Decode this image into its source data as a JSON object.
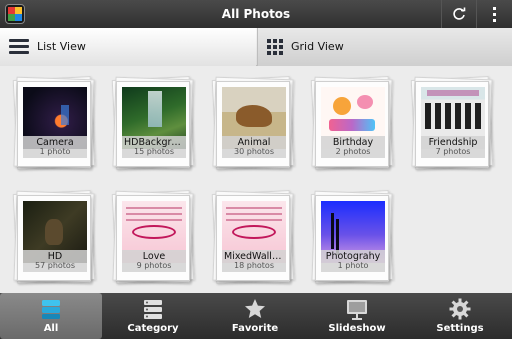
{
  "header": {
    "title": "All Photos",
    "app_icon": "app-logo-icon",
    "refresh_icon": "refresh-icon",
    "menu_icon": "overflow-menu-icon"
  },
  "view_toggle": {
    "list_label": "List View",
    "grid_label": "Grid View",
    "selected": "list"
  },
  "albums": [
    {
      "name": "Camera",
      "count": "1 photo",
      "thumb": "t-camera"
    },
    {
      "name": "HDBackgrou...",
      "count": "15 photos",
      "thumb": "t-hd"
    },
    {
      "name": "Animal",
      "count": "30 photos",
      "thumb": "t-animal"
    },
    {
      "name": "Birthday",
      "count": "2 photos",
      "thumb": "t-birthday"
    },
    {
      "name": "Friendship",
      "count": "7 photos",
      "thumb": "t-friend"
    },
    {
      "name": "HD",
      "count": "57 photos",
      "thumb": "t-hd2"
    },
    {
      "name": "Love",
      "count": "9 photos",
      "thumb": "t-love"
    },
    {
      "name": "MixedWallpa...",
      "count": "18 photos",
      "thumb": "t-love"
    },
    {
      "name": "Photograhy",
      "count": "1 photo",
      "thumb": "t-photo"
    }
  ],
  "bottom_nav": [
    {
      "label": "All",
      "icon": "layers-icon",
      "active": true
    },
    {
      "label": "Category",
      "icon": "category-list-icon",
      "active": false
    },
    {
      "label": "Favorite",
      "icon": "star-icon",
      "active": false
    },
    {
      "label": "Slideshow",
      "icon": "slideshow-icon",
      "active": false
    },
    {
      "label": "Settings",
      "icon": "gear-icon",
      "active": false
    }
  ],
  "colors": {
    "accent": "#1fa8d8",
    "bar_dark": "#2f2f2f"
  }
}
